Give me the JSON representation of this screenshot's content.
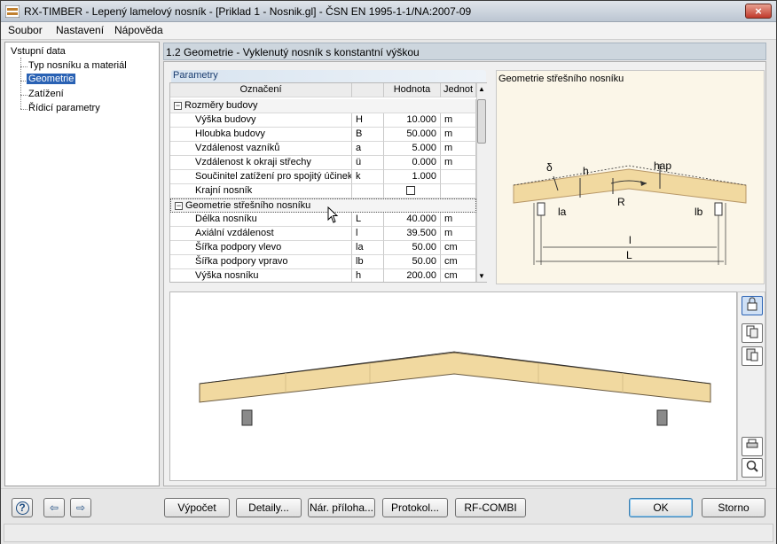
{
  "window": {
    "title": "RX-TIMBER - Lepený lamelový nosník - [Priklad 1 - Nosnik.gl] - ČSN EN 1995-1-1/NA:2007-09",
    "close": "×"
  },
  "menu": {
    "items": [
      "Soubor",
      "Nastavení",
      "Nápověda"
    ]
  },
  "tree": {
    "root": "Vstupní data",
    "items": [
      "Typ nosníku a materiál",
      "Geometrie",
      "Zatížení",
      "Řídicí parametry"
    ],
    "selected": 1
  },
  "header": {
    "title": "1.2 Geometrie  -  Vyklenutý nosník s konstantní výškou"
  },
  "params": {
    "label": "Parametry",
    "columns": [
      "Označení",
      "",
      "Hodnota",
      "Jednot"
    ],
    "groups": [
      {
        "name": "Rozměry budovy",
        "rows": [
          {
            "name": "Výška budovy",
            "sym": "H",
            "val": "10.000",
            "unit": "m"
          },
          {
            "name": "Hloubka budovy",
            "sym": "B",
            "val": "50.000",
            "unit": "m"
          },
          {
            "name": "Vzdálenost vazníků",
            "sym": "a",
            "val": "5.000",
            "unit": "m"
          },
          {
            "name": "Vzdálenost k okraji střechy",
            "sym": "ü",
            "val": "0.000",
            "unit": "m"
          },
          {
            "name": "Součinitel zatížení pro spojitý účinek",
            "sym": "k",
            "val": "1.000",
            "unit": ""
          },
          {
            "name": "Krajní nosník",
            "sym": "",
            "val": "",
            "unit": "",
            "checkbox": true
          }
        ]
      },
      {
        "name": "Geometrie střešního nosníku",
        "rows": [
          {
            "name": "Délka nosníku",
            "sym": "L",
            "val": "40.000",
            "unit": "m"
          },
          {
            "name": "Axiální vzdálenost",
            "sym": "l",
            "val": "39.500",
            "unit": "m"
          },
          {
            "name": "Šířka podpory vlevo",
            "sym": "la",
            "val": "50.00",
            "unit": "cm"
          },
          {
            "name": "Šířka podpory vpravo",
            "sym": "lb",
            "val": "50.00",
            "unit": "cm"
          },
          {
            "name": "Výška nosníku",
            "sym": "h",
            "val": "200.00",
            "unit": "cm"
          }
        ]
      }
    ]
  },
  "image_panel": {
    "title": "Geometrie střešního nosníku",
    "labels": {
      "delta": "δ",
      "h": "h",
      "hap": "hap",
      "la": "la",
      "lb": "lb",
      "R": "R",
      "l": "l",
      "L": "L"
    }
  },
  "toolbar": {
    "icons": [
      "lock-icon",
      "copy-icon",
      "paste-icon",
      "print-icon",
      "zoom-icon"
    ]
  },
  "buttons": {
    "help": "?",
    "import": "⇦",
    "export": "⇨",
    "vypocet": "Výpočet",
    "detaily": "Detaily...",
    "narpriloha": "Nár. příloha...",
    "protokol": "Protokol...",
    "rfcombi": "RF-COMBI",
    "ok": "OK",
    "storno": "Storno"
  },
  "colors": {
    "accent": "#2a62b4",
    "beam": "#f1d9a0",
    "beam_stroke": "#5a4a30",
    "header_bg": "#cdd6de"
  }
}
